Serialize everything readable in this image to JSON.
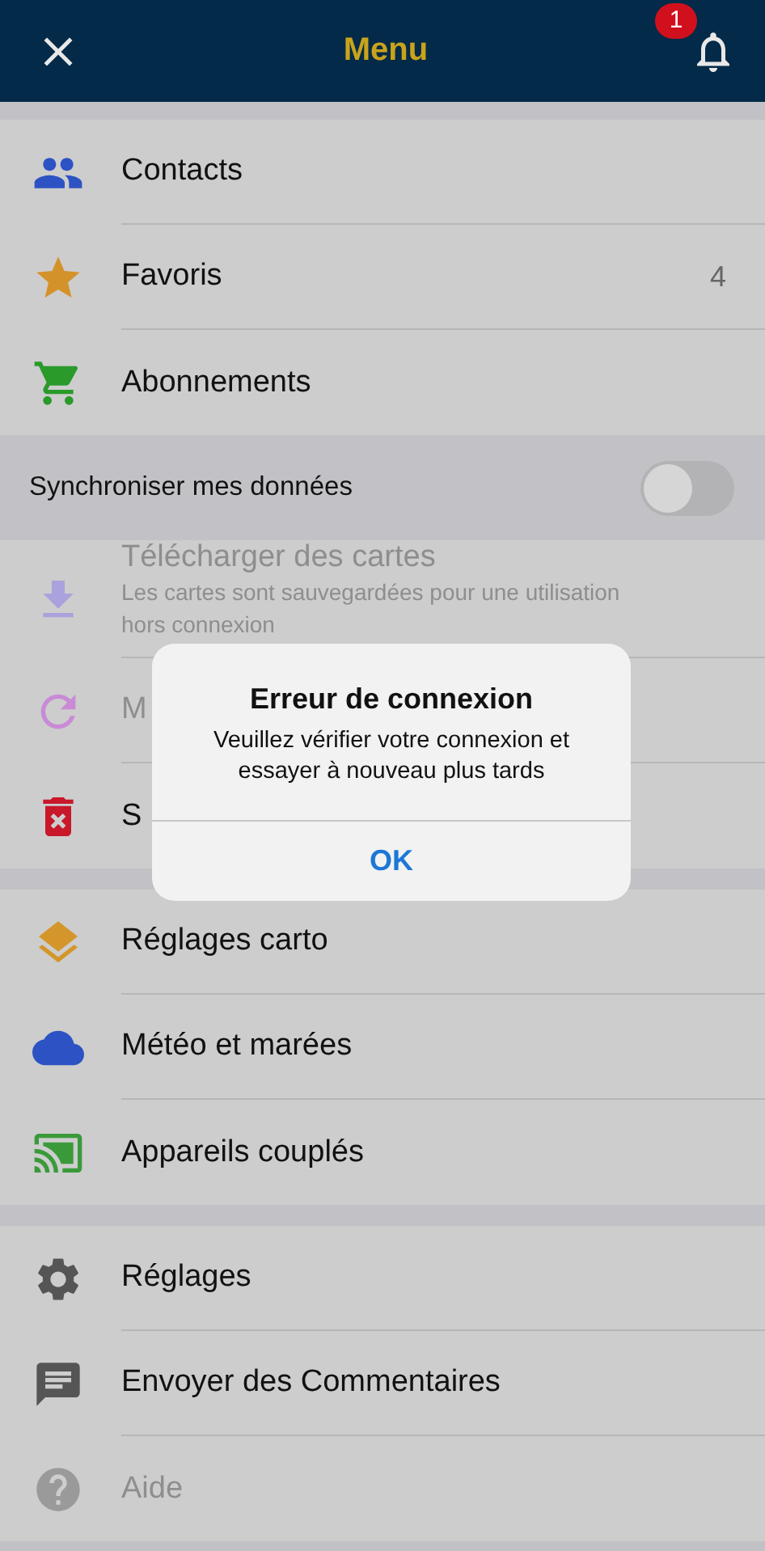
{
  "header": {
    "title": "Menu",
    "badge": "1"
  },
  "groups": [
    {
      "items": [
        {
          "kind": "link",
          "label": "Contacts",
          "disabled": false
        },
        {
          "kind": "link",
          "label": "Favoris",
          "count": "4",
          "disabled": false
        },
        {
          "kind": "link",
          "label": "Abonnements",
          "disabled": false
        },
        {
          "kind": "toggle",
          "label": "Synchroniser mes données",
          "on": false
        },
        {
          "kind": "link",
          "label": "Télécharger des cartes",
          "subtitle": "Les cartes sont sauvegardées pour une utilisation hors connexion",
          "disabled": true
        },
        {
          "kind": "link",
          "label": "M",
          "disabled": true
        },
        {
          "kind": "link",
          "label": "S",
          "disabled": false
        }
      ]
    },
    {
      "items": [
        {
          "kind": "link",
          "label": "Réglages carto",
          "disabled": false
        },
        {
          "kind": "link",
          "label": "Météo et marées",
          "disabled": false
        },
        {
          "kind": "link",
          "label": "Appareils couplés",
          "disabled": false
        }
      ]
    },
    {
      "items": [
        {
          "kind": "link",
          "label": "Réglages",
          "disabled": false
        },
        {
          "kind": "link",
          "label": "Envoyer des Commentaires",
          "disabled": false
        },
        {
          "kind": "link",
          "label": "Aide",
          "disabled": true
        }
      ]
    }
  ],
  "dialog": {
    "title": "Erreur de connexion",
    "message": "Veuillez vérifier votre connexion et essayer à nouveau plus tards",
    "button": "OK"
  }
}
